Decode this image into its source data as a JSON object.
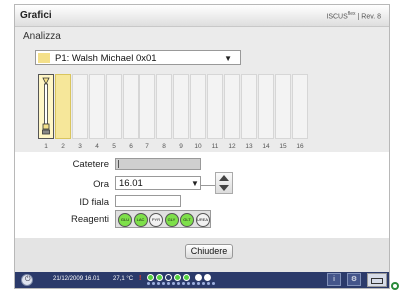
{
  "window": {
    "title": "Grafici",
    "brand": "ISCUS",
    "brand_superscript": "flex",
    "brand_suffix": "| Rev. 8"
  },
  "analysis": {
    "section_title": "Analizza",
    "patient_dropdown": {
      "selected": "P1: Walsh Michael 0x01",
      "swatch_color": "#f4e08a"
    },
    "slots": [
      {
        "label": "1",
        "state": "active",
        "has_syringe": true
      },
      {
        "label": "2",
        "state": "selected"
      },
      {
        "label": "3",
        "state": "empty"
      },
      {
        "label": "4",
        "state": "empty"
      },
      {
        "label": "5",
        "state": "empty"
      },
      {
        "label": "6",
        "state": "empty"
      },
      {
        "label": "7",
        "state": "empty"
      },
      {
        "label": "8",
        "state": "empty"
      },
      {
        "label": "9",
        "state": "empty"
      },
      {
        "label": "10",
        "state": "empty"
      },
      {
        "label": "11",
        "state": "empty"
      },
      {
        "label": "12",
        "state": "empty"
      },
      {
        "label": "13",
        "state": "empty"
      },
      {
        "label": "14",
        "state": "empty"
      },
      {
        "label": "15",
        "state": "empty"
      },
      {
        "label": "16",
        "state": "empty"
      }
    ]
  },
  "form": {
    "catetere_label": "Catetere",
    "catetere_value": "",
    "ora_label": "Ora",
    "ora_value": "16.01",
    "idfiala_label": "ID fiala",
    "idfiala_value": "",
    "reagenti_label": "Reagenti",
    "reagents": [
      {
        "code": "GLU",
        "active": true
      },
      {
        "code": "LAC",
        "active": true
      },
      {
        "code": "PYR",
        "active": false
      },
      {
        "code": "GLY",
        "active": true
      },
      {
        "code": "GLT",
        "active": true
      },
      {
        "code": "UREA",
        "active": false
      }
    ]
  },
  "actions": {
    "close_label": "Chiudere"
  },
  "statusbar": {
    "datetime": "21/12/2009 16.01",
    "temperature": "27,1 °C",
    "alert_symbol": "!"
  },
  "colors": {
    "reagent_active": "#7ee04a",
    "statusbar_bg": "#2b3a6a",
    "selected_slot": "#f6e79a"
  }
}
